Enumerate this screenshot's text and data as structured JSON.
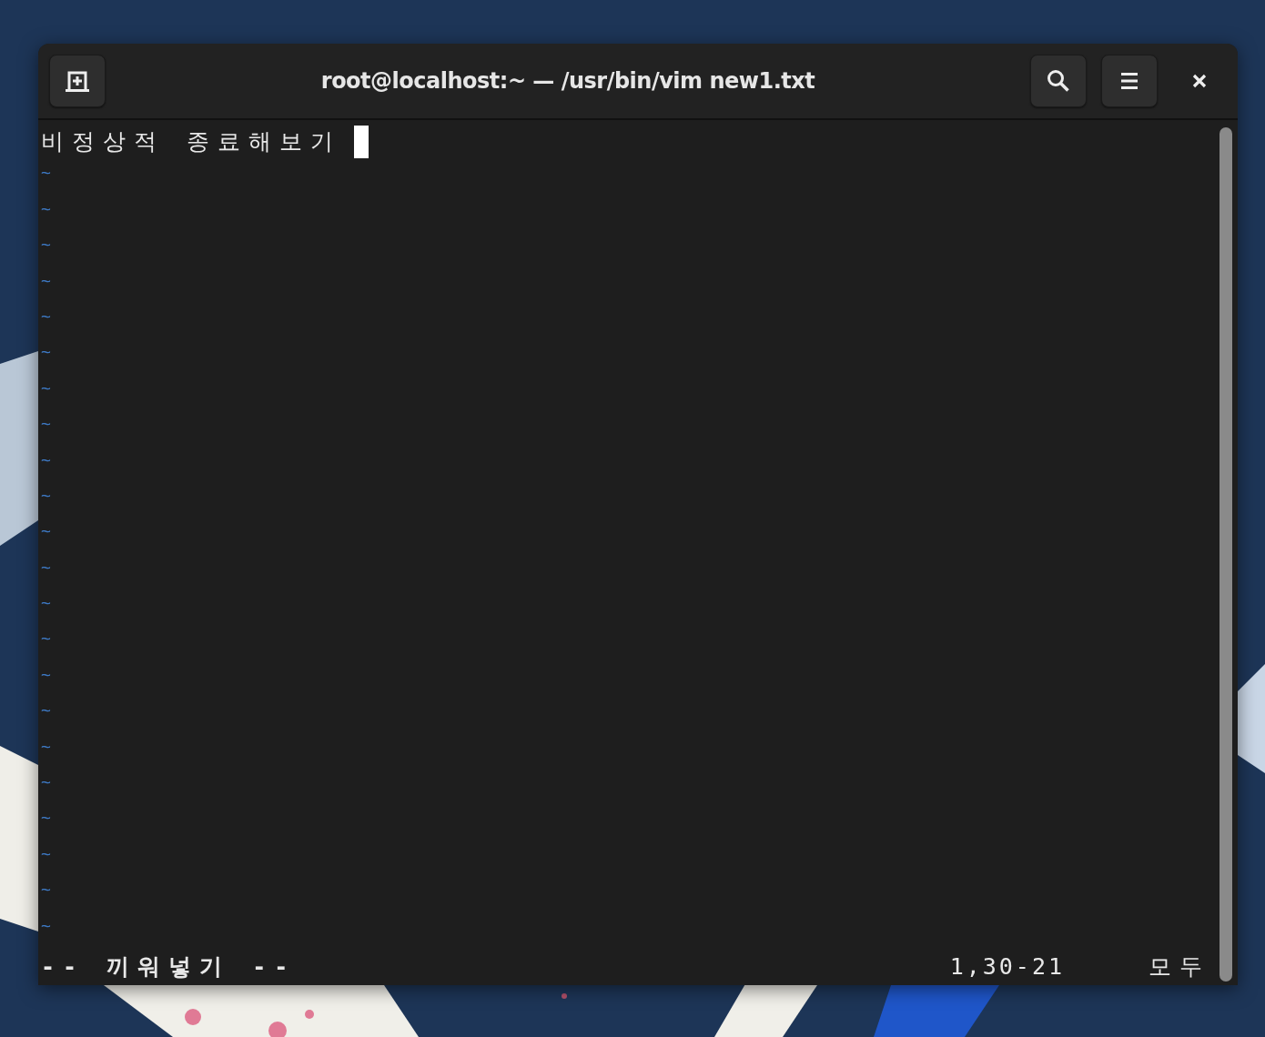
{
  "window": {
    "title": "root@localhost:~ — /usr/bin/vim new1.txt"
  },
  "editor": {
    "lines": [
      "비정상적 종료해보기"
    ],
    "empty_line_markers": [
      "~",
      "~",
      "~",
      "~",
      "~",
      "~",
      "~",
      "~",
      "~",
      "~",
      "~",
      "~",
      "~",
      "~",
      "~",
      "~",
      "~",
      "~",
      "~",
      "~",
      "~",
      "~"
    ]
  },
  "status_line": {
    "mode": "-- 끼워넣기 --",
    "position": "1,30-21",
    "scroll": "모두"
  }
}
